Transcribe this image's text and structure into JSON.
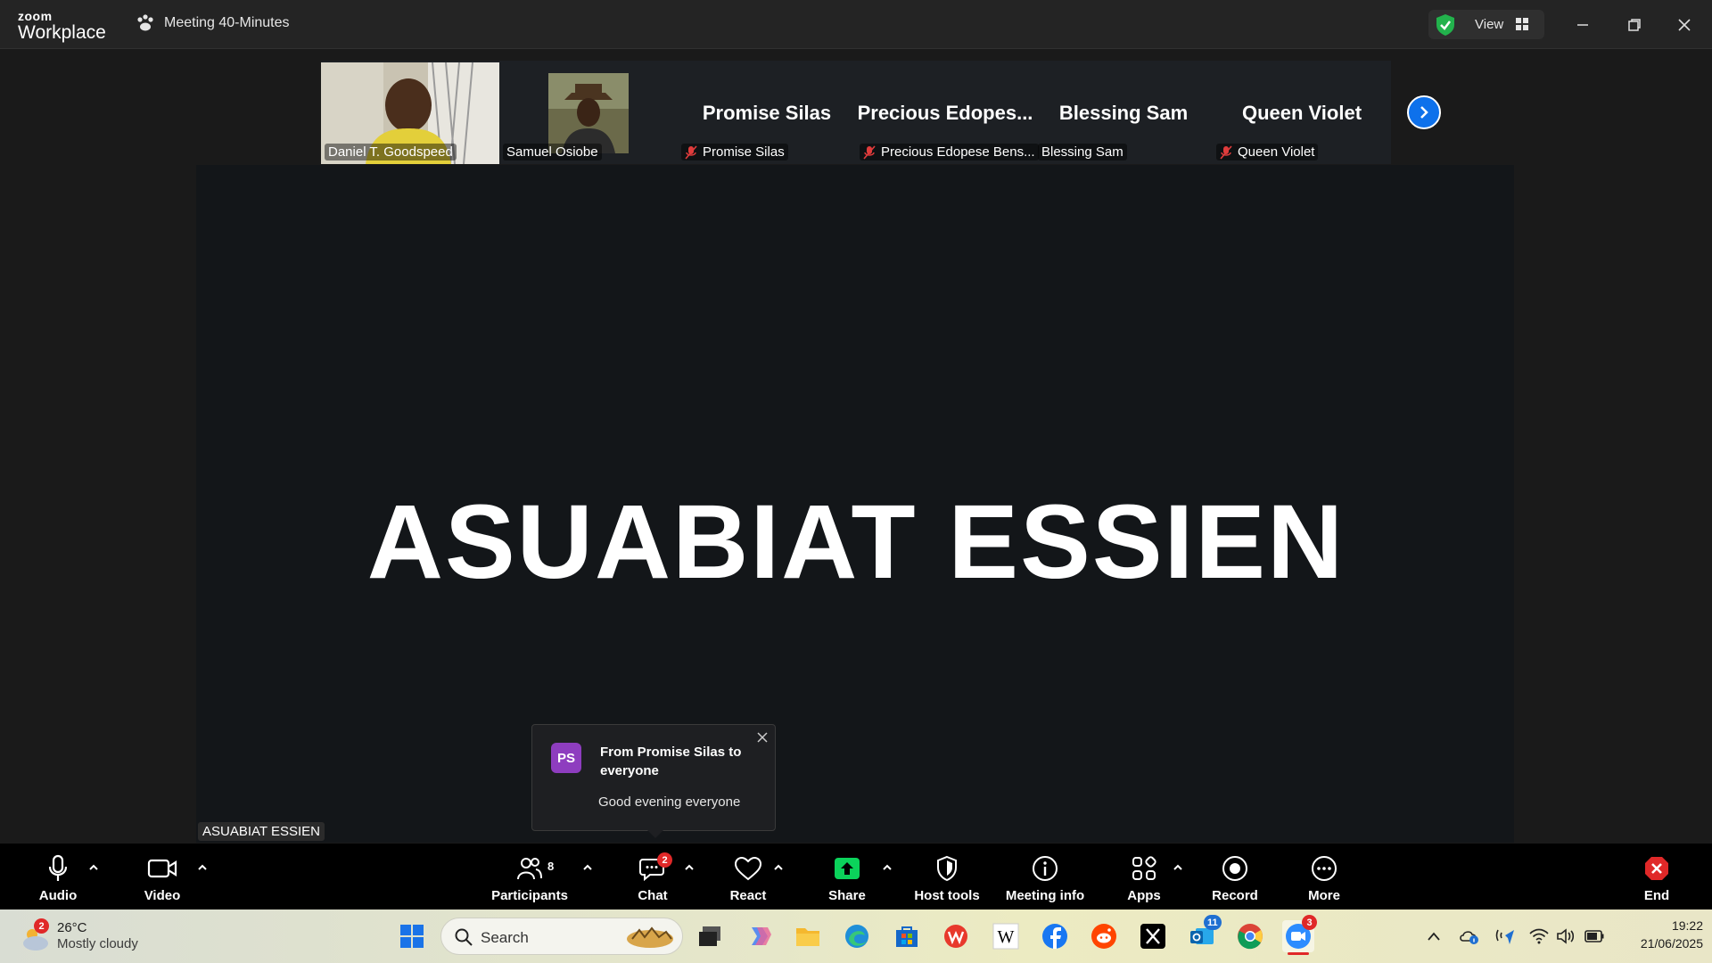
{
  "app": {
    "logo_top": "zoom",
    "logo_bottom": "Workplace",
    "meeting_title": "Meeting 40-Minutes",
    "view_label": "View"
  },
  "participants_strip": [
    {
      "name": "Daniel T. Goodspeed",
      "video": true,
      "muted": false
    },
    {
      "name": "Samuel Osiobe",
      "video": true,
      "muted": false
    },
    {
      "name": "Promise Silas",
      "big": "Promise Silas",
      "muted": true
    },
    {
      "name": "Precious Edopese Bens...",
      "big": "Precious  Edopes...",
      "muted": true
    },
    {
      "name": "Blessing Sam",
      "big": "Blessing Sam",
      "muted": false
    },
    {
      "name": "Queen Violet",
      "big": "Queen Violet",
      "muted": true
    }
  ],
  "main_speaker": {
    "display_name": "ASUABIAT ESSIEN",
    "label": "ASUABIAT ESSIEN"
  },
  "chat_toast": {
    "initials": "PS",
    "from": "From Promise Silas to everyone",
    "message": "Good evening everyone"
  },
  "toolbar": {
    "audio": "Audio",
    "video": "Video",
    "participants": "Participants",
    "participants_count": "8",
    "chat": "Chat",
    "chat_badge": "2",
    "react": "React",
    "share": "Share",
    "host_tools": "Host tools",
    "meeting_info": "Meeting info",
    "apps": "Apps",
    "record": "Record",
    "more": "More",
    "end": "End"
  },
  "taskbar": {
    "weather_badge": "2",
    "temperature": "26°C",
    "condition": "Mostly cloudy",
    "search_placeholder": "Search",
    "outlook_badge": "11",
    "zoom_badge": "3",
    "time": "19:22",
    "date": "21/06/2025"
  },
  "colors": {
    "accent_blue": "#0e71eb",
    "end_red": "#e02828",
    "share_green": "#0bd35b",
    "avatar_purple": "#8e3dbf"
  }
}
